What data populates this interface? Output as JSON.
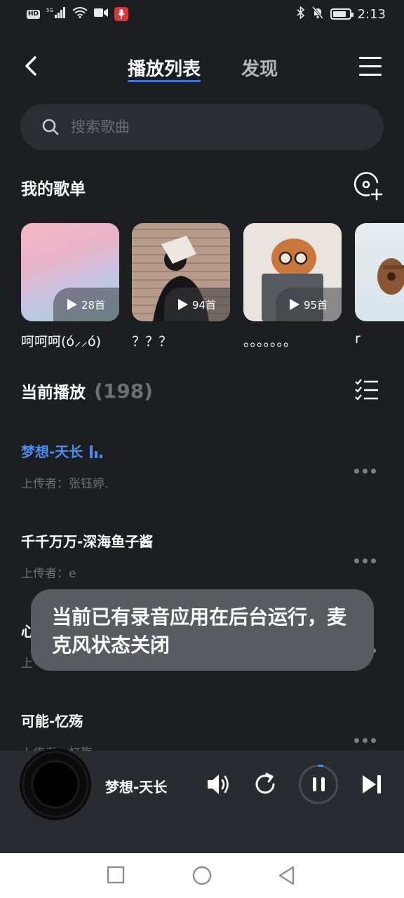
{
  "status_bar": {
    "time": "2:13",
    "network": "5G",
    "hd": "HD"
  },
  "header": {
    "tabs": [
      {
        "label": "播放列表"
      },
      {
        "label": "发现"
      }
    ]
  },
  "search": {
    "placeholder": "搜索歌曲"
  },
  "my_playlists": {
    "title": "我的歌单",
    "items": [
      {
        "name": "呵呵呵(ó⸝⸝ó)",
        "count": "28首"
      },
      {
        "name": "？？？",
        "count": "94首"
      },
      {
        "name": "。。。。。。。",
        "count": "95首"
      },
      {
        "name": "r",
        "count": ""
      }
    ]
  },
  "now_playing_list": {
    "title": "当前播放",
    "count": "(198)",
    "songs": [
      {
        "title": "梦想-天长",
        "uploader": "上传者：张钰婷.",
        "active": true
      },
      {
        "title": "千千万万-深海鱼子酱",
        "uploader": "上传者：e"
      },
      {
        "title": "心",
        "uploader": "上"
      },
      {
        "title": "可能-忆殇",
        "uploader": "上传者：忆殇"
      }
    ]
  },
  "toast": {
    "message": "当前已有录音应用在后台运行，麦克风状态关闭"
  },
  "player": {
    "title": "梦想-天长"
  },
  "colors": {
    "accent": "#4a8cf2",
    "background": "#1d1e22",
    "toast": "#5a5b61"
  }
}
